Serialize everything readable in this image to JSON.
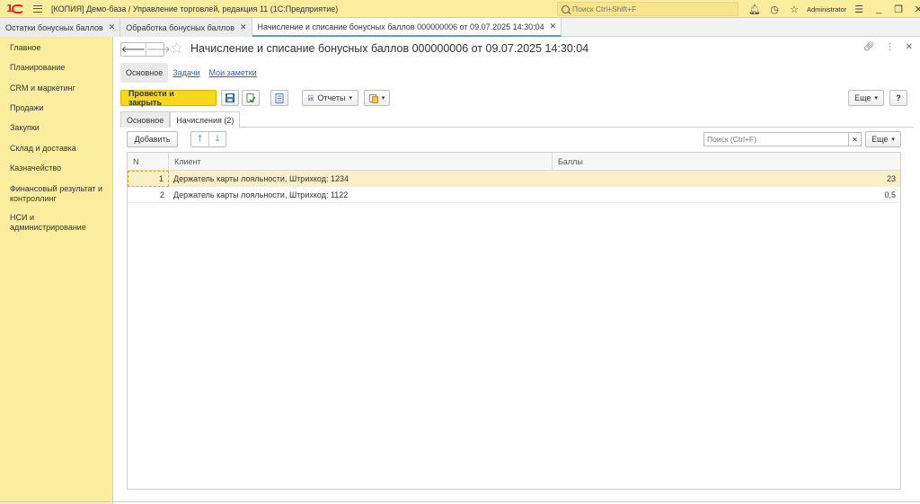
{
  "app": {
    "logo": "1С",
    "title": "[КОПИЯ] Демо-база / Управление торговлей, редакция 11  (1С:Предприятие)",
    "search_placeholder": "Поиск Ctrl+Shift+F",
    "user": "Administrator"
  },
  "window_tabs": [
    {
      "label": "Остатки бонусных баллов"
    },
    {
      "label": "Обработка бонусных баллов"
    },
    {
      "label": "Начисление и списание бонусных баллов 000000006 от 09.07.2025 14:30:04"
    }
  ],
  "sidebar": {
    "items": [
      {
        "label": "Главное"
      },
      {
        "label": "Планирование"
      },
      {
        "label": "CRM и маркетинг"
      },
      {
        "label": "Продажи"
      },
      {
        "label": "Закупки"
      },
      {
        "label": "Склад и доставка"
      },
      {
        "label": "Казначейство"
      },
      {
        "label": "Финансовый результат и контроллинг"
      },
      {
        "label": "НСИ и администрирование"
      }
    ]
  },
  "form": {
    "title": "Начисление и списание бонусных баллов 000000006 от 09.07.2025 14:30:04",
    "nav": {
      "back": "🡐",
      "forward": "🡒"
    },
    "subnav": {
      "main": "Основное",
      "tasks": "Задачи",
      "notes": "Мои заметки"
    },
    "toolbar": {
      "post_close": "Провести и закрыть",
      "reports": "Отчеты",
      "more": "Еще",
      "help": "?"
    },
    "tabs": {
      "main": "Основное",
      "accruals": "Начисления (2)"
    },
    "table_toolbar": {
      "add": "Добавить",
      "search_placeholder": "Поиск (Ctrl+F)",
      "more": "Еще"
    },
    "table": {
      "columns": {
        "n": "N",
        "client": "Клиент",
        "points": "Баллы"
      },
      "rows": [
        {
          "n": "1",
          "client": "Держатель карты лояльности, Штрихкод: 1234",
          "points": "23"
        },
        {
          "n": "2",
          "client": "Держатель карты лояльности, Штрихкод: 1122",
          "points": "0,5"
        }
      ]
    }
  },
  "colors": {
    "accent_yellow": "#f7d81e",
    "sidebar_bg": "#fbed9e",
    "link": "#2b63b5"
  }
}
